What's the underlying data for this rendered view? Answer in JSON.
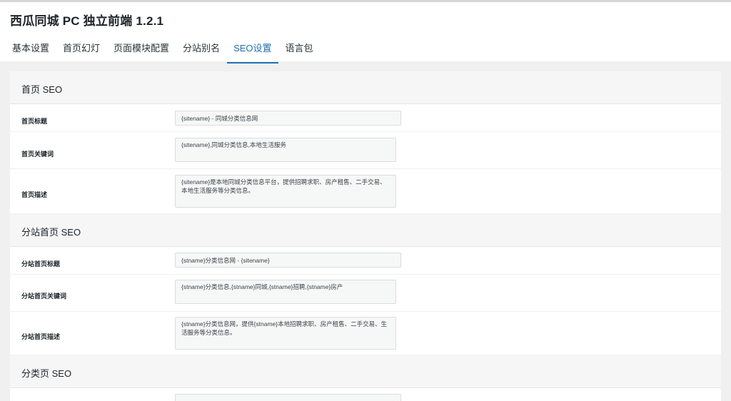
{
  "app": {
    "title": "西瓜同城 PC 独立前端 1.2.1"
  },
  "tabs": [
    {
      "label": "基本设置",
      "active": false
    },
    {
      "label": "首页幻灯",
      "active": false
    },
    {
      "label": "页面模块配置",
      "active": false
    },
    {
      "label": "分站别名",
      "active": false
    },
    {
      "label": "SEO设置",
      "active": true
    },
    {
      "label": "语言包",
      "active": false
    }
  ],
  "sections": [
    {
      "title": "首页 SEO",
      "fields": [
        {
          "label": "首页标题",
          "value": "{sitename} - 同城分类信息网"
        },
        {
          "label": "首页关键词",
          "value": "{sitename},同城分类信息,本地生活服务"
        },
        {
          "label": "首页描述",
          "value": "{sitename}是本地同城分类信息平台，提供招聘求职、房产租售、二手交易、本地生活服务等分类信息。"
        }
      ]
    },
    {
      "title": "分站首页 SEO",
      "fields": [
        {
          "label": "分站首页标题",
          "value": "{stname}分类信息网 - {sitename}"
        },
        {
          "label": "分站首页关键词",
          "value": "{stname}分类信息,{stname}同城,{stname}招聘,{stname}房产"
        },
        {
          "label": "分站首页描述",
          "value": "{stname}分类信息网，提供{stname}本地招聘求职、房产租售、二手交易、生活服务等分类信息。"
        }
      ]
    },
    {
      "title": "分类页 SEO",
      "fields": []
    }
  ],
  "colors": {
    "accent": "#2271b1",
    "page_bg": "#f0f0f1",
    "section_bg": "#f6f6f7"
  }
}
